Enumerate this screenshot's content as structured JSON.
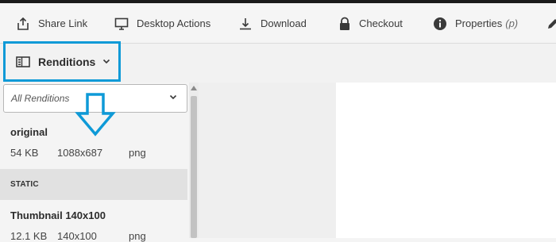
{
  "toolbar": {
    "items": [
      {
        "label": "Share Link",
        "icon": "share-icon"
      },
      {
        "label": "Desktop Actions",
        "icon": "desktop-icon"
      },
      {
        "label": "Download",
        "icon": "download-icon"
      },
      {
        "label": "Checkout",
        "icon": "lock-icon"
      },
      {
        "label": "Properties",
        "shortcut": "(p)",
        "icon": "info-icon"
      }
    ]
  },
  "renditions_button": {
    "label": "Renditions",
    "icon": "panel-icon"
  },
  "filter": {
    "value": "All Renditions"
  },
  "renditions": [
    {
      "name": "original",
      "size": "54 KB",
      "dimensions": "1088x687",
      "format": "png"
    },
    {
      "name": "Thumbnail 140x100",
      "size": "12.1 KB",
      "dimensions": "140x100",
      "format": "png"
    }
  ],
  "section": {
    "label": "STATIC"
  },
  "colors": {
    "highlight": "#0e9ad7",
    "section_bg": "#e1e1e1",
    "preview_bg": "#ffffff"
  }
}
